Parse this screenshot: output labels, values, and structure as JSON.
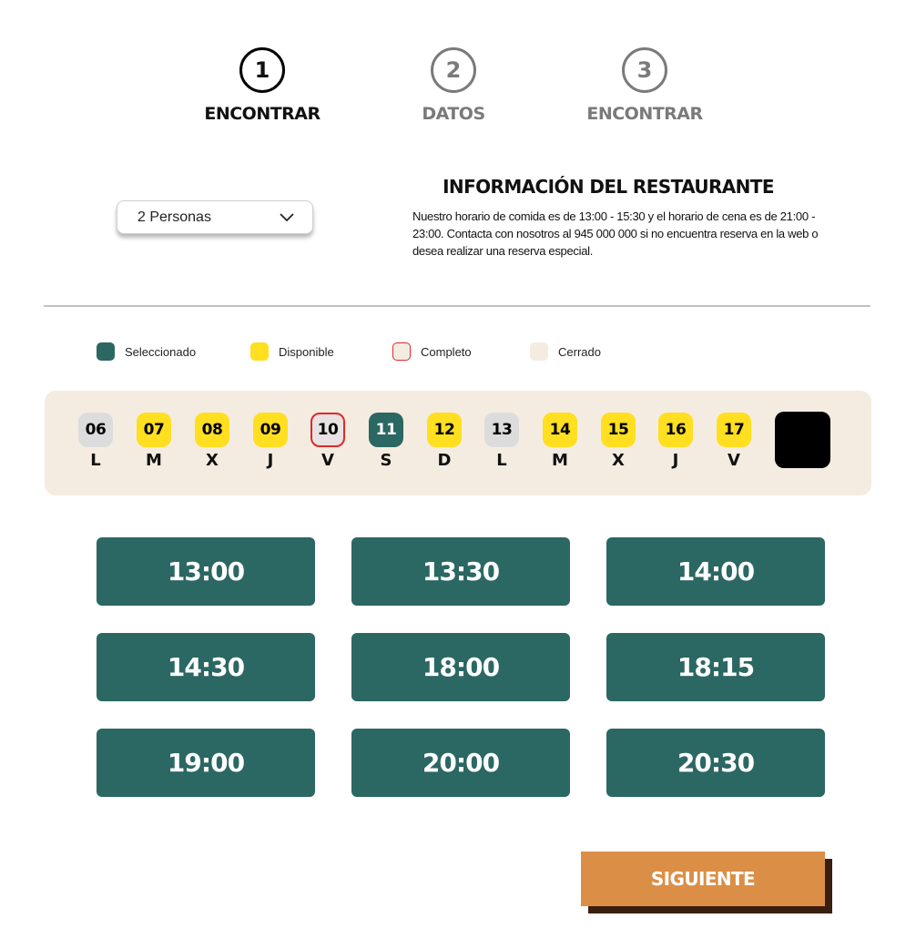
{
  "steps": [
    {
      "number": "1",
      "label": "ENCONTRAR",
      "active": true
    },
    {
      "number": "2",
      "label": "DATOS",
      "active": false
    },
    {
      "number": "3",
      "label": "ENCONTRAR",
      "active": false
    }
  ],
  "persons_select": {
    "value": "2 Personas",
    "icon": "chevron-down-icon"
  },
  "info": {
    "title": "INFORMACIÓN DEL RESTAURANTE",
    "text": "Nuestro horario de comida es de 13:00 - 15:30  y el horario de cena es de 21:00 - 23:00. Contacta con nosotros al 945 000 000  si no encuentra reserva en la web o desea realizar una reserva especial."
  },
  "legend": [
    {
      "label": "Seleccionado",
      "color": "#2b6763"
    },
    {
      "label": "Disponible",
      "color": "#ffdf1f"
    },
    {
      "label": "Completo",
      "color": "#e02828"
    },
    {
      "label": "Cerrado",
      "color": "#f4ece1"
    }
  ],
  "days": [
    {
      "num": "06",
      "weekday": "L",
      "status": "cerrado"
    },
    {
      "num": "07",
      "weekday": "M",
      "status": "disponible"
    },
    {
      "num": "08",
      "weekday": "X",
      "status": "disponible"
    },
    {
      "num": "09",
      "weekday": "J",
      "status": "disponible"
    },
    {
      "num": "10",
      "weekday": "V",
      "status": "completo"
    },
    {
      "num": "11",
      "weekday": "S",
      "status": "seleccionado"
    },
    {
      "num": "12",
      "weekday": "D",
      "status": "disponible"
    },
    {
      "num": "13",
      "weekday": "L",
      "status": "cerrado"
    },
    {
      "num": "14",
      "weekday": "M",
      "status": "disponible"
    },
    {
      "num": "15",
      "weekday": "X",
      "status": "disponible"
    },
    {
      "num": "16",
      "weekday": "J",
      "status": "disponible"
    },
    {
      "num": "17",
      "weekday": "V",
      "status": "disponible"
    }
  ],
  "times": [
    "13:00",
    "13:30",
    "14:00",
    "14:30",
    "18:00",
    "18:15",
    "19:00",
    "20:00",
    "20:30"
  ],
  "next_button": {
    "label": "SIGUIENTE"
  }
}
